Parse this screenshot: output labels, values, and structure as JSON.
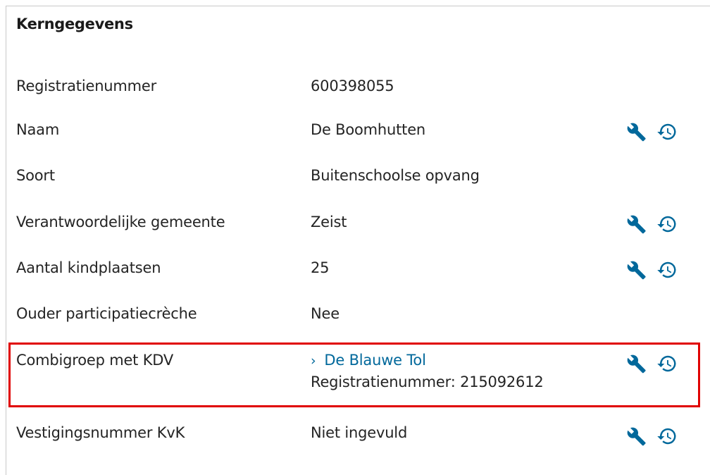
{
  "section": {
    "title": "Kerngegevens"
  },
  "rows": [
    {
      "label": "Registratienummer",
      "value": "600398055"
    },
    {
      "label": "Naam",
      "value": "De Boomhutten"
    },
    {
      "label": "Soort",
      "value": "Buitenschoolse opvang"
    },
    {
      "label": "Verantwoordelijke gemeente",
      "value": "Zeist"
    },
    {
      "label": "Aantal kindplaatsen",
      "value": "25"
    },
    {
      "label": "Ouder participatiecrèche",
      "value": "Nee"
    },
    {
      "label": "Combigroep met KDV",
      "link_chevron": "›",
      "link": "De Blauwe Tol",
      "sub": "Registratienummer: 215092612"
    },
    {
      "label": "Vestigingsnummer KvK",
      "value": "Niet ingevuld"
    }
  ],
  "icons": {
    "wrench": "wrench-icon",
    "history": "history-icon"
  },
  "colors": {
    "icon": "#01689b",
    "link": "#01689b",
    "highlight": "#e00000",
    "border": "#c9c9c9"
  }
}
